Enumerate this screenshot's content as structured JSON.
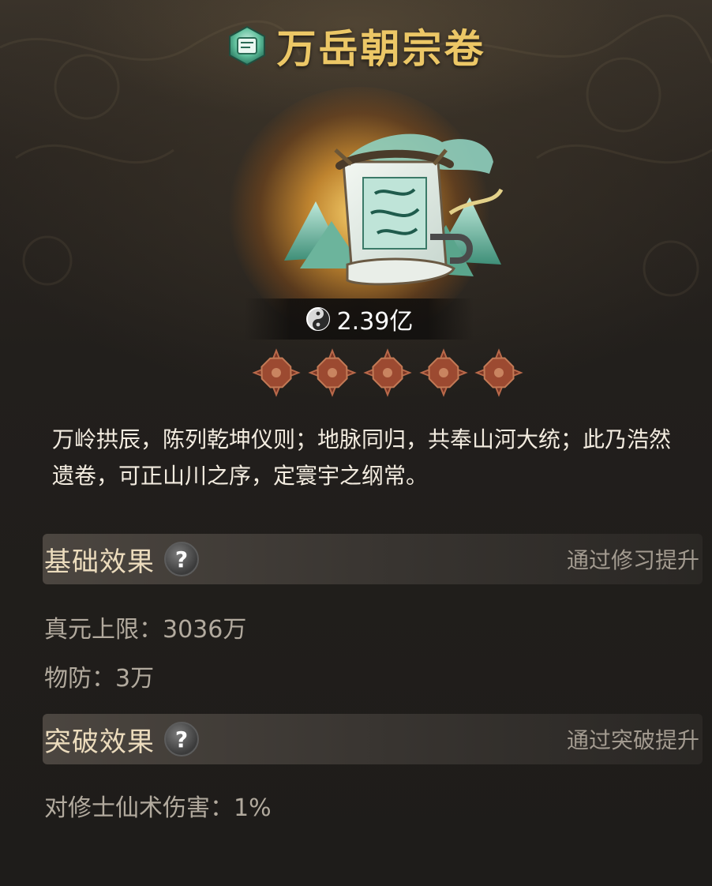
{
  "item": {
    "name": "万岳朝宗卷",
    "title_icon": "scroll-icon",
    "art": "mountain-scroll-artwork",
    "price": {
      "icon": "yin-yang-coin-icon",
      "value": "2.39亿"
    },
    "star_icon": "star-flower-icon",
    "stars": 5,
    "description": "万岭拱辰，陈列乾坤仪则；地脉同归，共奉山河大统；此乃浩然遗卷，可正山川之序，定寰宇之纲常。"
  },
  "sections": {
    "basic": {
      "title": "基础效果",
      "help": "?",
      "hint": "通过修习提升",
      "stats": [
        "真元上限：3036万",
        "物防：3万"
      ]
    },
    "breakthrough": {
      "title": "突破效果",
      "help": "?",
      "hint": "通过突破提升",
      "stats": [
        "对修士仙术伤害：1%"
      ]
    }
  },
  "colors": {
    "title_gold": "#ecc766",
    "desc_text": "#f3ece0",
    "stat_text": "#b2aa9e",
    "hint_text": "#a39b90",
    "section_bar": "#4e4842"
  }
}
